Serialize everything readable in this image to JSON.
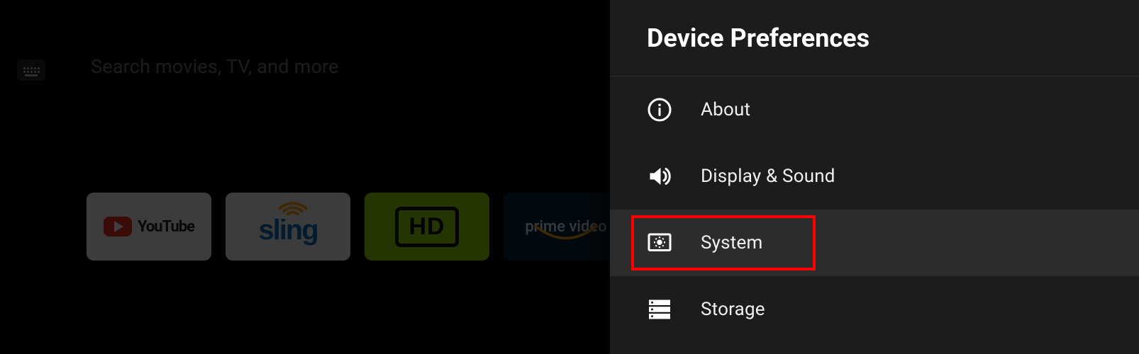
{
  "home": {
    "search_placeholder": "Search movies, TV, and more",
    "apps": {
      "youtube": "YouTube",
      "sling": "sling",
      "hd": "HD",
      "prime": "prime video"
    }
  },
  "panel": {
    "title": "Device Preferences",
    "items": [
      {
        "label": "About"
      },
      {
        "label": "Display & Sound"
      },
      {
        "label": "System"
      },
      {
        "label": "Storage"
      }
    ]
  },
  "annotation": {
    "highlighted_item": "System"
  }
}
